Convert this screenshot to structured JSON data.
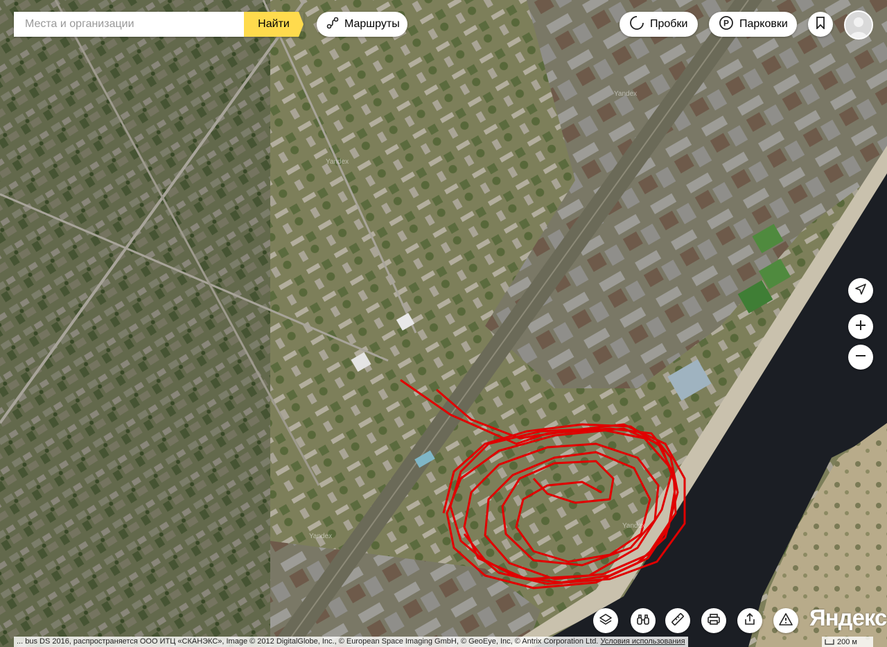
{
  "search": {
    "placeholder": "Места и организации",
    "button_label": "Найти"
  },
  "top_controls": {
    "routes_label": "Маршруты",
    "traffic_label": "Пробки",
    "parking_label": "Парковки"
  },
  "map": {
    "watermark": "Yandex",
    "track_color": "#e00000"
  },
  "footer": {
    "copyright": "... bus DS 2016, распространяется ООО ИТЦ «СКАНЭКС», Image © 2012 DigitalGlobe, Inc., © European Space Imaging GmbH, © GeoEye, Inc, © Antrix Corporation Ltd.",
    "terms_link": "Условия использования",
    "logo": "Яндекс",
    "scale_label": "200 м"
  },
  "icons": [
    "routes-icon",
    "traffic-icon",
    "parking-icon",
    "bookmark-icon",
    "avatar",
    "locate-icon",
    "zoom-in-icon",
    "zoom-out-icon",
    "layers-icon",
    "panorama-icon",
    "ruler-icon",
    "print-icon",
    "share-icon",
    "report-icon"
  ]
}
